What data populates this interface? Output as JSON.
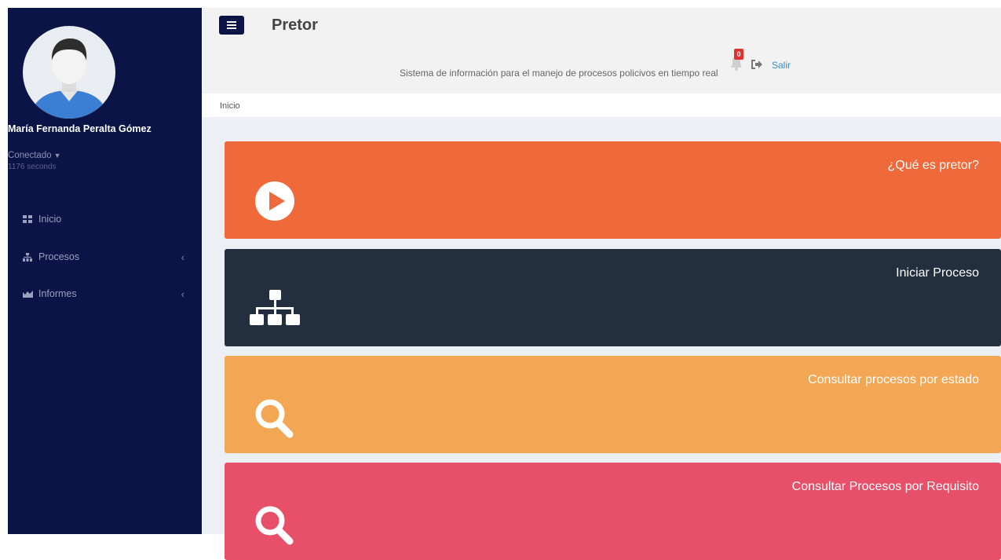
{
  "app": {
    "title": "Pretor",
    "tagline": "Sistema de información para el manejo de procesos policivos en tiempo real",
    "notifications_count": "0",
    "logout_label": "Salir"
  },
  "user": {
    "name": "María Fernanda Peralta Gómez",
    "status": "Conectado",
    "session_time": "1176 seconds"
  },
  "sidebar": {
    "items": [
      {
        "label": "Inicio",
        "icon": "dashboard-icon",
        "has_submenu": false
      },
      {
        "label": "Procesos",
        "icon": "sitemap-icon",
        "has_submenu": true
      },
      {
        "label": "Informes",
        "icon": "area-chart-icon",
        "has_submenu": true
      }
    ]
  },
  "breadcrumb": {
    "current": "Inicio"
  },
  "cards": [
    {
      "label": "¿Qué es pretor?",
      "icon": "play-circle-icon",
      "color": "#f0693a"
    },
    {
      "label": "Iniciar Proceso",
      "icon": "sitemap-icon",
      "color": "#232f3e"
    },
    {
      "label": "Consultar procesos por estado",
      "icon": "search-icon",
      "color": "#f3a755"
    },
    {
      "label": "Consultar Procesos por Requisito",
      "icon": "search-icon",
      "color": "#e8506a"
    }
  ],
  "colors": {
    "sidebar_bg": "#0b1446",
    "topbar_bg": "#f2f2f2",
    "content_bg": "#ecf0f5",
    "link": "#3c8dbc"
  }
}
